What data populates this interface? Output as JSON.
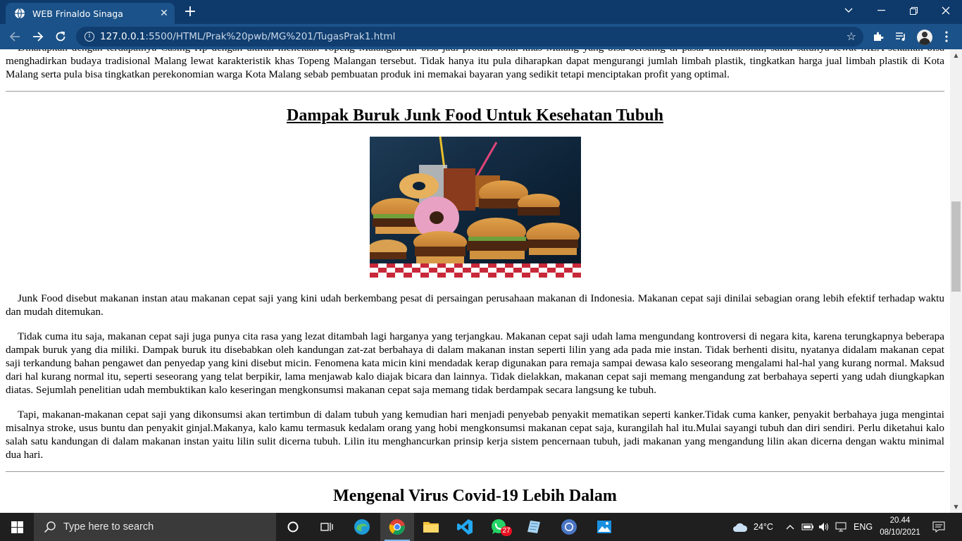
{
  "browser": {
    "tab_title": "WEB Frinaldo Sinaga",
    "tab_close": "✕",
    "new_tab": "+",
    "url_host": "127.0.0.1",
    "url_path": ":5500/HTML/Prak%20pwb/MG%201/TugasPrak1.html",
    "accent_color": "#1b5289",
    "tabbar_color": "#0e3a6b"
  },
  "content": {
    "intro_paragraph": "Diharapkan dengan terdapatnya Casing Hp dengan ukiran menelaah Topeng Malangan ini bisa jadi produk lokal khas Malang yang bisa bersaing di pasar internasional, salah satunya lewat MEA sekalian bisa menghadirkan budaya tradisional Malang lewat karakteristik khas Topeng Malangan tersebut. Tidak hanya itu pula diharapkan dapat mengurangi jumlah limbah plastik, tingkatkan harga jual limbah plastik di Kota Malang serta pula bisa tingkatkan perekonomian warga Kota Malang sebab pembuatan produk ini memakai bayaran yang sedikit tetapi menciptakan profit yang optimal.",
    "article_junk": {
      "heading": "Dampak Buruk Junk Food Untuk Kesehatan Tubuh",
      "image_desc": "junk-food-image",
      "paragraphs": [
        "Junk Food disebut makanan instan atau makanan cepat saji yang kini udah berkembang pesat di persaingan perusahaan makanan di Indonesia. Makanan cepat saji dinilai sebagian orang lebih efektif terhadap waktu dan mudah ditemukan.",
        "Tidak cuma itu saja, makanan cepat saji juga punya cita rasa yang lezat ditambah lagi harganya yang terjangkau. Makanan cepat saji udah lama mengundang kontroversi di negara kita, karena terungkapnya beberapa dampak buruk yang dia miliki. Dampak buruk itu disebabkan oleh kandungan zat-zat berbahaya di dalam makanan instan seperti lilin yang ada pada mie instan. Tidak berhenti disitu, nyatanya didalam makanan cepat saji terkandung bahan pengawet dan penyedap yang kini disebut micin. Fenomena kata micin kini mendadak kerap digunakan para remaja sampai dewasa kalo seseorang mengalami hal-hal yang kurang normal. Maksud dari hal kurang normal itu, seperti seseorang yang telat berpikir, lama menjawab kalo diajak bicara dan lainnya. Tidak dielakkan, makanan cepat saji memang mengandung zat berbahaya seperti yang udah diungkapkan diatas. Sejumlah penelitian udah membuktikan kalo keseringan mengkonsumsi makanan cepat saja memang tidak berdampak secara langsung ke tubuh.",
        "Tapi, makanan-makanan cepat saji yang dikonsumsi akan tertimbun di dalam tubuh yang kemudian hari menjadi penyebab penyakit mematikan seperti kanker.Tidak cuma kanker, penyakit berbahaya juga mengintai misalnya stroke, usus buntu dan penyakit ginjal.Makanya, kalo kamu termasuk kedalam orang yang hobi mengkonsumsi makanan cepat saja, kurangilah hal itu.Mulai sayangi tubuh dan diri sendiri. Perlu diketahui kalo salah satu kandungan di dalam makanan instan yaitu lilin sulit dicerna tubuh. Lilin itu menghancurkan prinsip kerja sistem pencernaan tubuh, jadi makanan yang mengandung lilin akan dicerna dengan waktu minimal dua hari."
      ]
    },
    "article_covid": {
      "heading": "Mengenal Virus Covid-19 Lebih Dalam"
    }
  },
  "taskbar": {
    "search_placeholder": "Type here to search",
    "whatsapp_badge": "27",
    "weather": "24°C",
    "language": "ENG",
    "time": "20.44",
    "date": "08/10/2021",
    "background": "#1f1f1f"
  }
}
